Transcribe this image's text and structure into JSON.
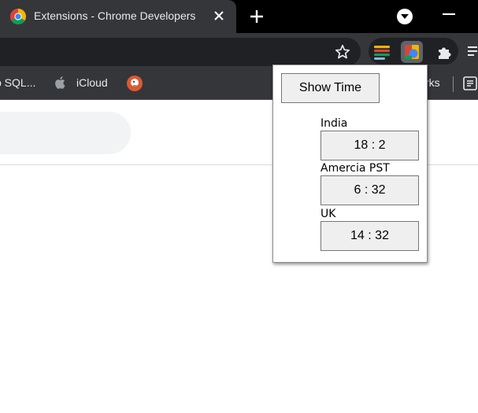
{
  "tab": {
    "title": "Extensions - Chrome Developers",
    "favicon_icon": "chrome-logo-icon",
    "close_icon": "close-icon"
  },
  "tabstrip": {
    "new_tab_icon": "plus-icon",
    "tab_search_icon": "chevron-down-circle-icon",
    "minimize_icon": "minimize-icon"
  },
  "toolbar": {
    "bookmark_star_icon": "star-outline-icon",
    "extensions": [
      {
        "name": "stack-extension-icon"
      },
      {
        "name": "timezone-extension-icon"
      },
      {
        "name": "puzzle-icon"
      }
    ],
    "menu_icon": "reading-list-icon"
  },
  "bookmarks": {
    "items": [
      {
        "label": "p SQL...",
        "icon": "folder-icon"
      },
      {
        "label": "iCloud",
        "icon": "apple-icon"
      },
      {
        "label": "",
        "icon": "duckduckgo-icon"
      }
    ],
    "overflow_label": "rks",
    "reading_icon": "reading-list-icon"
  },
  "popup": {
    "button_label": "Show Time",
    "zones": [
      {
        "label": "India",
        "time": "18 : 2"
      },
      {
        "label": "Amercia PST",
        "time": "6 : 32"
      },
      {
        "label": "UK",
        "time": "14 : 32"
      }
    ]
  },
  "colors": {
    "tab_bg": "#35363a",
    "frame_bg": "#000000",
    "omnibox_bg": "#202124",
    "page_bg": "#ffffff"
  }
}
